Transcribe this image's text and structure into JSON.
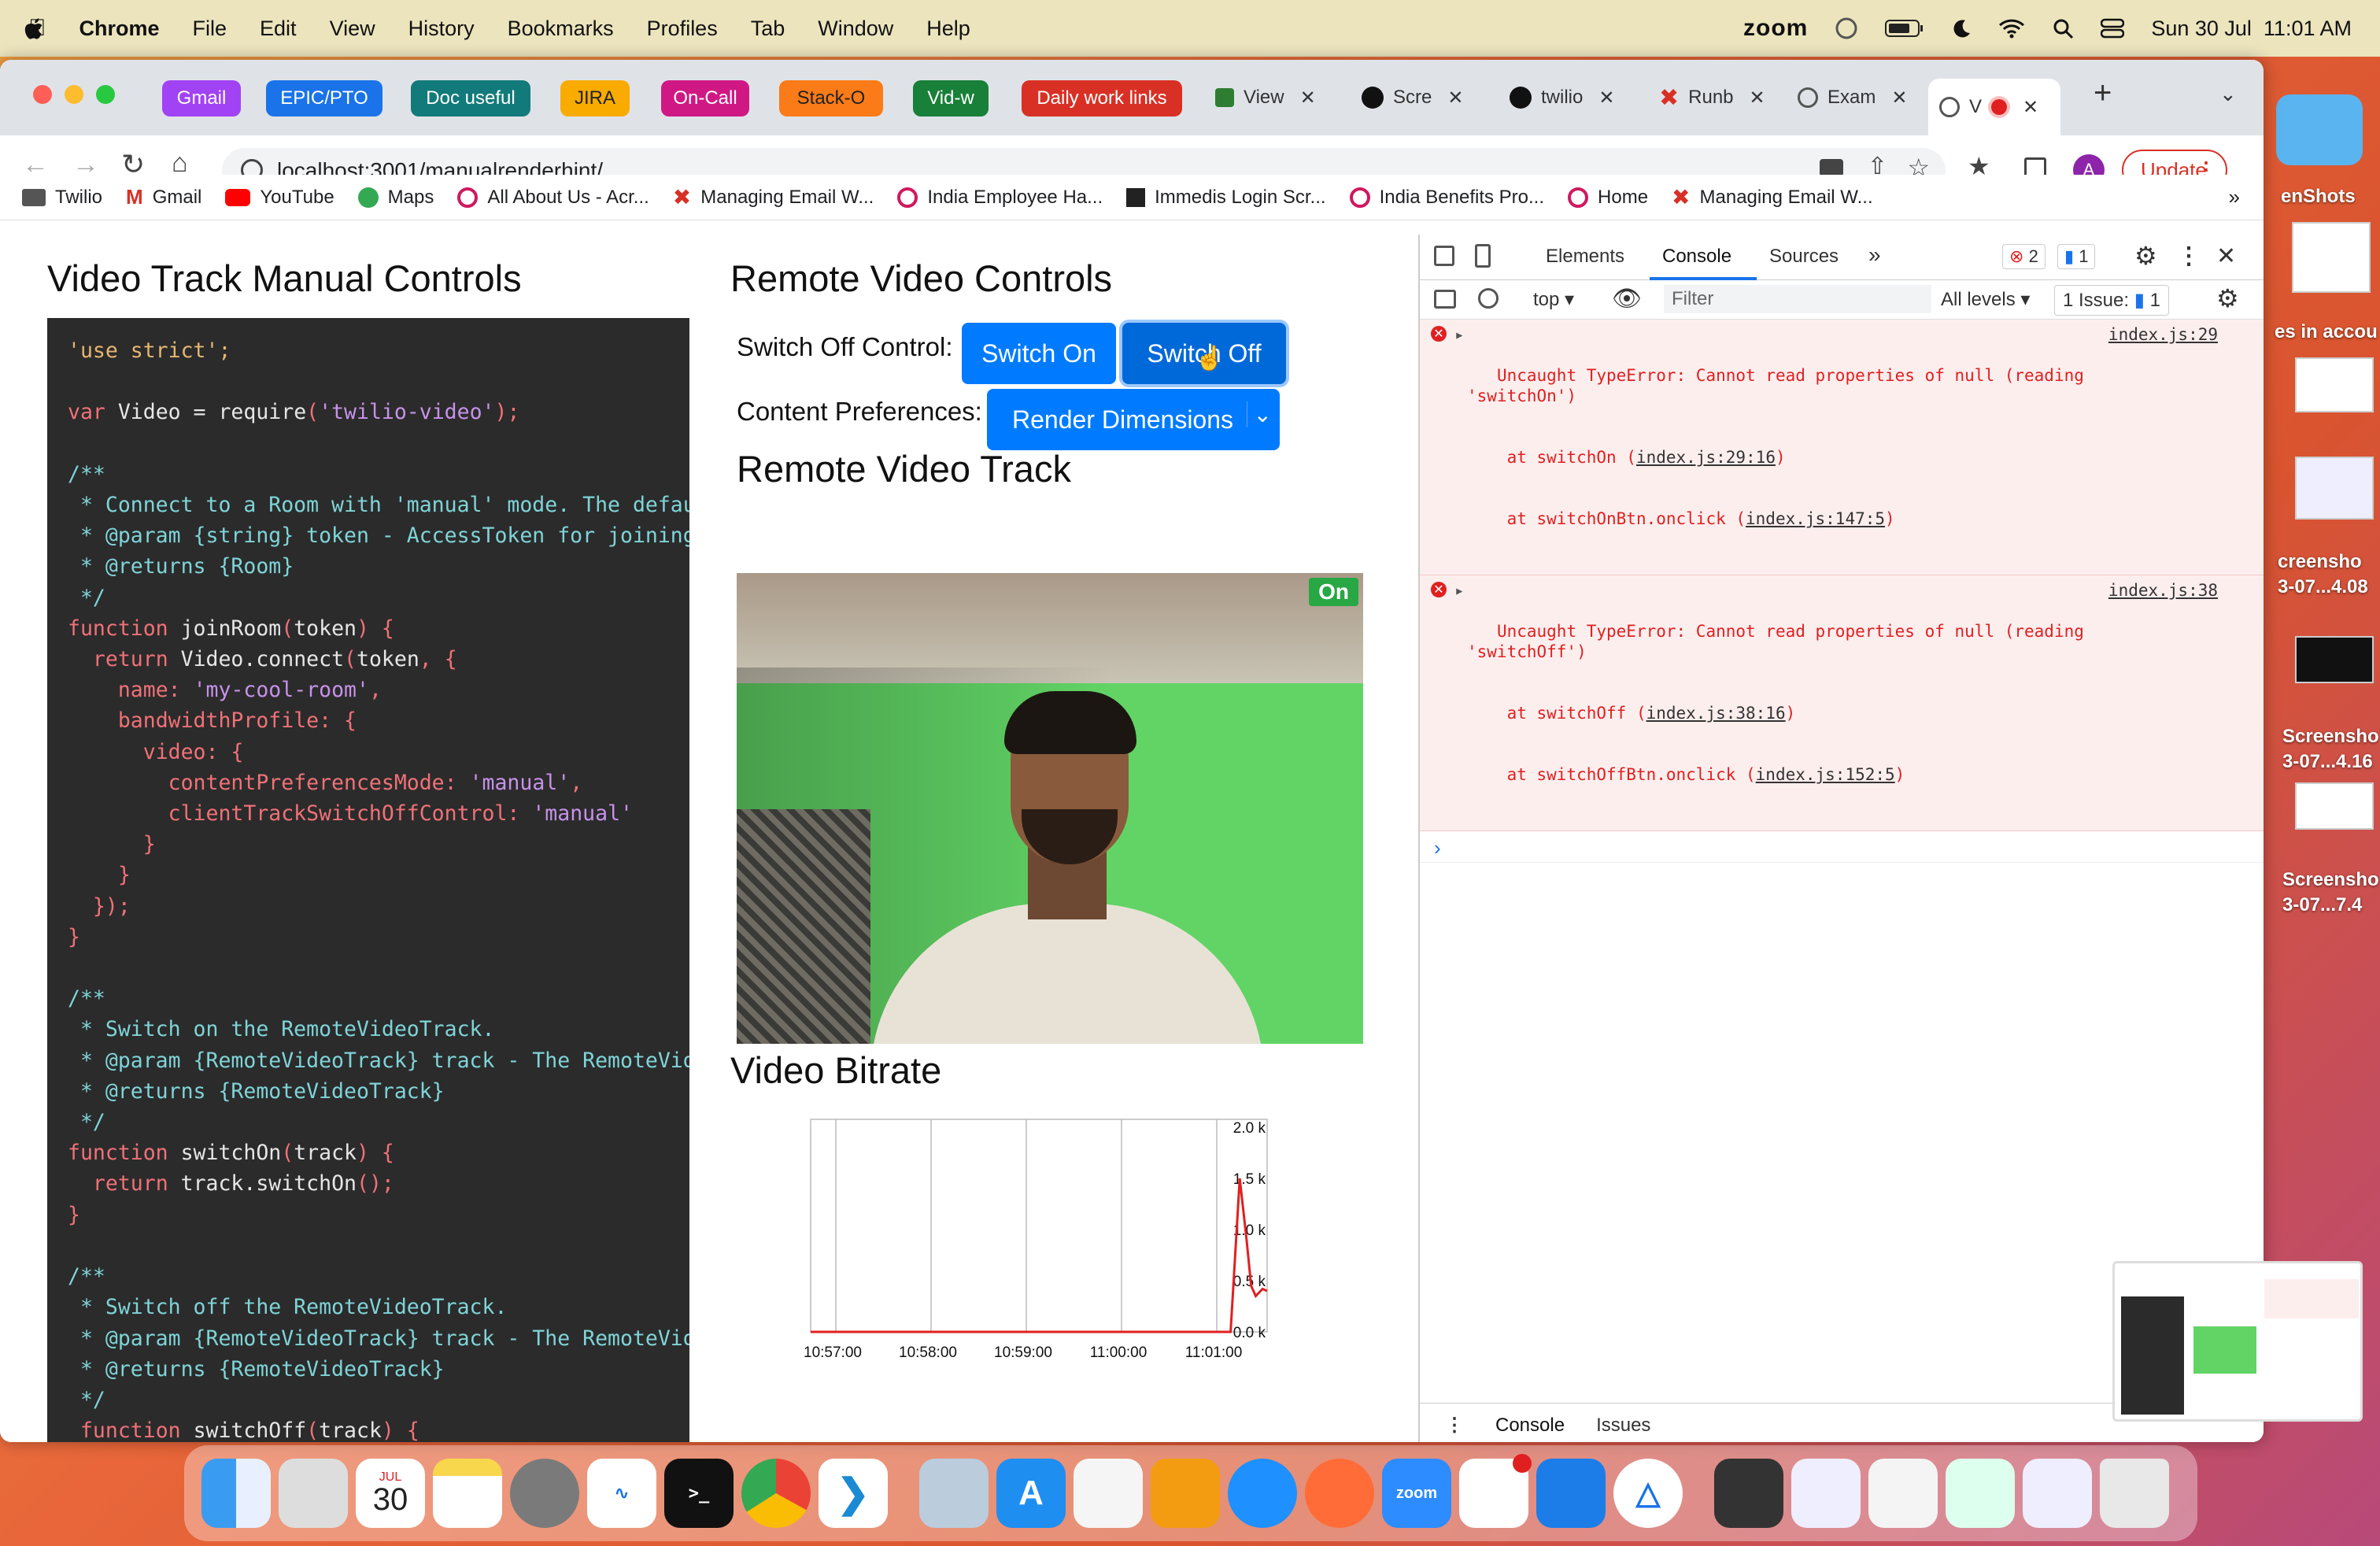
{
  "menubar": {
    "app": "Chrome",
    "items": [
      "File",
      "Edit",
      "View",
      "History",
      "Bookmarks",
      "Profiles",
      "Tab",
      "Window",
      "Help"
    ],
    "zoom": "zoom",
    "datetime": "Sun 30 Jul  11:01 AM"
  },
  "tabs": {
    "groups": [
      {
        "label": "Gmail",
        "color": "#a142f4"
      },
      {
        "label": "EPIC/PTO",
        "color": "#1a73e8"
      },
      {
        "label": "Doc useful",
        "color": "#127a7a"
      },
      {
        "label": "JIRA",
        "color": "#f9ab00"
      },
      {
        "label": "On-Call",
        "color": "#d01884"
      },
      {
        "label": "Stack-O",
        "color": "#fa7b17"
      },
      {
        "label": "Vid-w",
        "color": "#188038"
      },
      {
        "label": "Daily work links",
        "color": "#d93025"
      }
    ],
    "pages": [
      {
        "label": "View"
      },
      {
        "label": "Scre"
      },
      {
        "label": "twilio"
      },
      {
        "label": "Runb"
      },
      {
        "label": "Exam"
      },
      {
        "label": "V"
      }
    ]
  },
  "address": {
    "url": "localhost:3001/manualrenderhint/",
    "update": "Update",
    "profile": "A"
  },
  "bookmarks": [
    "Twilio",
    "Gmail",
    "YouTube",
    "Maps",
    "All About Us - Acr...",
    "Managing Email W...",
    "India Employee Ha...",
    "Immedis Login Scr...",
    "India Benefits Pro...",
    "Home",
    "Managing Email W..."
  ],
  "left": {
    "title": "Video Track Manual Controls",
    "code": [
      "'use strict';",
      "",
      "var Video = require('twilio-video');",
      "",
      "/**",
      " * Connect to a Room with 'manual' mode. The defaul",
      " * @param {string} token - AccessToken for joining",
      " * @returns {Room}",
      " */",
      "function joinRoom(token) {",
      "  return Video.connect(token, {",
      "    name: 'my-cool-room',",
      "    bandwidthProfile: {",
      "      video: {",
      "        contentPreferencesMode: 'manual',",
      "        clientTrackSwitchOffControl: 'manual'",
      "      }",
      "    }",
      "  });",
      "}",
      "",
      "/**",
      " * Switch on the RemoteVideoTrack.",
      " * @param {RemoteVideoTrack} track - The RemoteVide",
      " * @returns {RemoteVideoTrack}",
      " */",
      "function switchOn(track) {",
      "  return track.switchOn();",
      "}",
      "",
      "/**",
      " * Switch off the RemoteVideoTrack.",
      " * @param {RemoteVideoTrack} track - The RemoteVide",
      " * @returns {RemoteVideoTrack}",
      " */",
      " function switchOff(track) {"
    ]
  },
  "right": {
    "title": "Remote Video Controls",
    "switch_label": "Switch Off Control:",
    "switch_on": "Switch On",
    "switch_off": "Switch Off",
    "content_label": "Content Preferences:",
    "content_select": "Render Dimensions",
    "track_title": "Remote Video Track",
    "track_badge": "On",
    "bitrate_title": "Video Bitrate"
  },
  "chart_data": {
    "type": "line",
    "title": "",
    "x_ticks": [
      "10:57:00",
      "10:58:00",
      "10:59:00",
      "11:00:00",
      "11:01:00"
    ],
    "y_ticks": [
      "0.0 k",
      "0.5 k",
      "1.0 k",
      "1.5 k",
      "2.0 k"
    ],
    "ylim": [
      0,
      2000
    ],
    "series": [
      {
        "color": "#e02020",
        "x": [
          0,
          0.9,
          0.92,
          0.94,
          0.955,
          0.965,
          0.975,
          0.99,
          1.0
        ],
        "values": [
          0,
          0,
          0,
          1500,
          900,
          450,
          350,
          420,
          400
        ]
      }
    ]
  },
  "devtools": {
    "tabs": [
      "Elements",
      "Console",
      "Sources"
    ],
    "errors_count": "2",
    "messages_count": "1",
    "context": "top",
    "filter_placeholder": "Filter",
    "levels": "All levels",
    "issues": "1 Issue:",
    "issues_count": "1",
    "errors": [
      {
        "msg": "Uncaught TypeError: Cannot read properties of null (reading\n'switchOn')",
        "link": "index.js:29",
        "stack": [
          {
            "fn": "at switchOn (",
            "loc": "index.js:29:16",
            ")": ")"
          },
          {
            "fn": "at switchOnBtn.onclick (",
            "loc": "index.js:147:5"
          }
        ]
      },
      {
        "msg": "Uncaught TypeError: Cannot read properties of null (reading\n'switchOff')",
        "link": "index.js:38",
        "stack": [
          {
            "fn": "at switchOff (",
            "loc": "index.js:38:16"
          },
          {
            "fn": "at switchOffBtn.onclick (",
            "loc": "index.js:152:5"
          }
        ]
      }
    ],
    "drawer": [
      "Console",
      "Issues"
    ]
  },
  "desktop": [
    "enShots",
    "es in accou",
    "creensho",
    "3-07...4.08",
    "Screensho",
    "3-07...4.16",
    "Screensho",
    "3-07...7.4"
  ],
  "dock": {
    "calendar_month": "JUL",
    "calendar_day": "30",
    "zoom": "zoom"
  }
}
